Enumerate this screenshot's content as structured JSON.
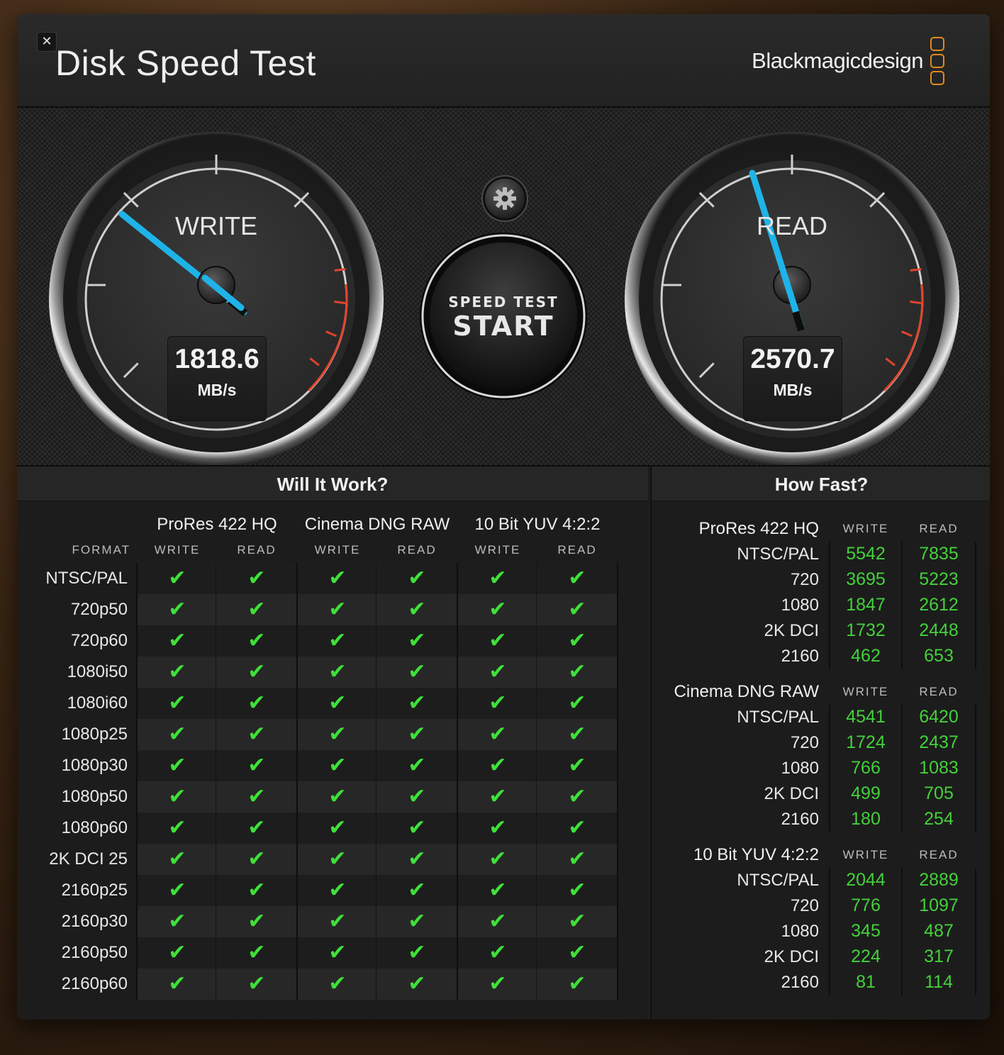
{
  "app": {
    "title": "Disk Speed Test",
    "brand": "Blackmagicdesign",
    "close_glyph": "✕"
  },
  "gauges": {
    "write": {
      "label": "WRITE",
      "value": "1818.6",
      "unit": "MB/s"
    },
    "read": {
      "label": "READ",
      "value": "2570.7",
      "unit": "MB/s"
    }
  },
  "start_button": {
    "top_label": "SPEED TEST",
    "main_label": "START"
  },
  "settings_icon": "gear-icon",
  "will_it_work": {
    "title": "Will It Work?",
    "format_header": "FORMAT",
    "groups": [
      {
        "name": "ProRes 422 HQ",
        "write": "WRITE",
        "read": "READ"
      },
      {
        "name": "Cinema DNG RAW",
        "write": "WRITE",
        "read": "READ"
      },
      {
        "name": "10 Bit YUV 4:2:2",
        "write": "WRITE",
        "read": "READ"
      }
    ],
    "rows": [
      {
        "format": "NTSC/PAL",
        "checks": [
          true,
          true,
          true,
          true,
          true,
          true
        ]
      },
      {
        "format": "720p50",
        "checks": [
          true,
          true,
          true,
          true,
          true,
          true
        ]
      },
      {
        "format": "720p60",
        "checks": [
          true,
          true,
          true,
          true,
          true,
          true
        ]
      },
      {
        "format": "1080i50",
        "checks": [
          true,
          true,
          true,
          true,
          true,
          true
        ]
      },
      {
        "format": "1080i60",
        "checks": [
          true,
          true,
          true,
          true,
          true,
          true
        ]
      },
      {
        "format": "1080p25",
        "checks": [
          true,
          true,
          true,
          true,
          true,
          true
        ]
      },
      {
        "format": "1080p30",
        "checks": [
          true,
          true,
          true,
          true,
          true,
          true
        ]
      },
      {
        "format": "1080p50",
        "checks": [
          true,
          true,
          true,
          true,
          true,
          true
        ]
      },
      {
        "format": "1080p60",
        "checks": [
          true,
          true,
          true,
          true,
          true,
          true
        ]
      },
      {
        "format": "2K DCI 25",
        "checks": [
          true,
          true,
          true,
          true,
          true,
          true
        ]
      },
      {
        "format": "2160p25",
        "checks": [
          true,
          true,
          true,
          true,
          true,
          true
        ]
      },
      {
        "format": "2160p30",
        "checks": [
          true,
          true,
          true,
          true,
          true,
          true
        ]
      },
      {
        "format": "2160p50",
        "checks": [
          true,
          true,
          true,
          true,
          true,
          true
        ]
      },
      {
        "format": "2160p60",
        "checks": [
          true,
          true,
          true,
          true,
          true,
          true
        ]
      }
    ],
    "check_glyph": "✔",
    "check_color": "#3fe03a"
  },
  "how_fast": {
    "title": "How Fast?",
    "write_header": "WRITE",
    "read_header": "READ",
    "value_color": "#43d13a",
    "categories": [
      {
        "name": "ProRes 422 HQ",
        "rows": [
          {
            "label": "NTSC/PAL",
            "write": "5542",
            "read": "7835"
          },
          {
            "label": "720",
            "write": "3695",
            "read": "5223"
          },
          {
            "label": "1080",
            "write": "1847",
            "read": "2612"
          },
          {
            "label": "2K DCI",
            "write": "1732",
            "read": "2448"
          },
          {
            "label": "2160",
            "write": "462",
            "read": "653"
          }
        ]
      },
      {
        "name": "Cinema DNG RAW",
        "rows": [
          {
            "label": "NTSC/PAL",
            "write": "4541",
            "read": "6420"
          },
          {
            "label": "720",
            "write": "1724",
            "read": "2437"
          },
          {
            "label": "1080",
            "write": "766",
            "read": "1083"
          },
          {
            "label": "2K DCI",
            "write": "499",
            "read": "705"
          },
          {
            "label": "2160",
            "write": "180",
            "read": "254"
          }
        ]
      },
      {
        "name": "10 Bit YUV 4:2:2",
        "rows": [
          {
            "label": "NTSC/PAL",
            "write": "2044",
            "read": "2889"
          },
          {
            "label": "720",
            "write": "776",
            "read": "1097"
          },
          {
            "label": "1080",
            "write": "345",
            "read": "487"
          },
          {
            "label": "2K DCI",
            "write": "224",
            "read": "317"
          },
          {
            "label": "2160",
            "write": "81",
            "read": "114"
          }
        ]
      }
    ]
  },
  "colors": {
    "needle": "#1fb3e8",
    "redline": "#e0442c",
    "brand_logo": "#e08a1e"
  }
}
